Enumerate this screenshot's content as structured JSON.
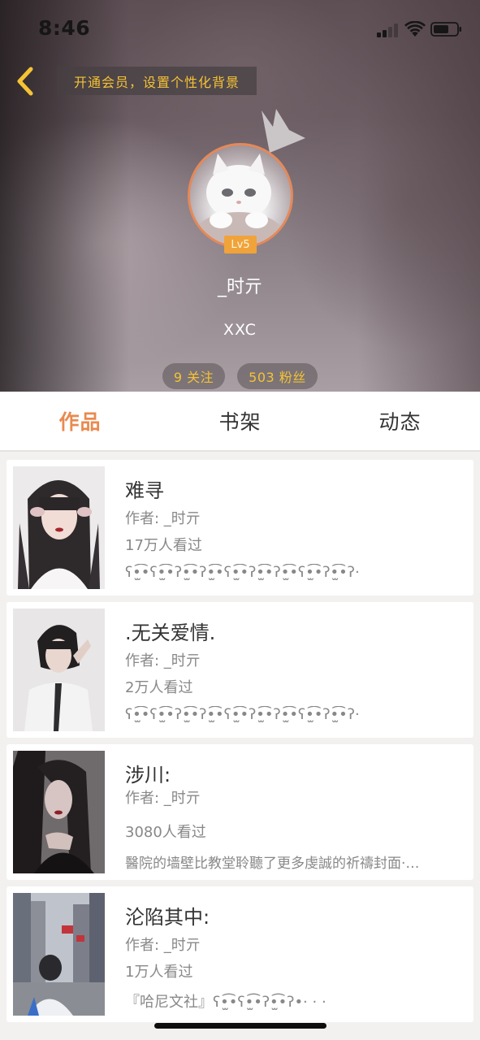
{
  "status_bar": {
    "time": "8:46"
  },
  "header": {
    "vip_banner": "开通会员，设置个性化背景",
    "level_badge": "Lv5",
    "username": "_时亓",
    "bio": "XXC",
    "follow_stat": "9 关注",
    "fans_stat": "503 粉丝"
  },
  "icons": {
    "back": "chevron-left-icon",
    "crown": "crown-icon",
    "signal": "cellular-signal-icon",
    "wifi": "wifi-icon",
    "battery": "battery-icon"
  },
  "colors": {
    "accent_orange": "#e98a4f",
    "gold_text": "#f5c235",
    "level_badge": "#f0a33a",
    "avatar_ring": "#e4895a",
    "secondary_text": "#888888"
  },
  "tabs": [
    {
      "label": "作品",
      "active": true
    },
    {
      "label": "书架",
      "active": false
    },
    {
      "label": "动态",
      "active": false
    }
  ],
  "books": [
    {
      "title": "难寻",
      "author": "作者: _时亓",
      "views": "17万人看过",
      "description": "ʕ•̫͡•ʕ•̫͡•ʔ•̫͡•ʔ•̫͡•ʕ•̫͡•ʔ•̫͡•ʔ•̫͡•ʕ•̫͡•ʔ•̫͡•ʔ·"
    },
    {
      "title": ".无关爱情.",
      "author": "作者: _时亓",
      "views": "2万人看过",
      "description": "ʕ•̫͡•ʕ•̫͡•ʔ•̫͡•ʔ•̫͡•ʕ•̫͡•ʔ•̫͡•ʔ•̫͡•ʕ•̫͡•ʔ•̫͡•ʔ·"
    },
    {
      "title": "涉川:",
      "author": "作者: _时亓",
      "views": "3080人看过",
      "description": "醫院的墙壁比教堂聆聽了更多虔誠的祈禱封面·…"
    },
    {
      "title": "沦陷其中:",
      "author": "作者: _时亓",
      "views": "1万人看过",
      "description": "『哈尼文社』ʕ•̫͡•ʕ•̫͡•ʔ•̫͡•ʔ•·  ·  ·"
    }
  ]
}
